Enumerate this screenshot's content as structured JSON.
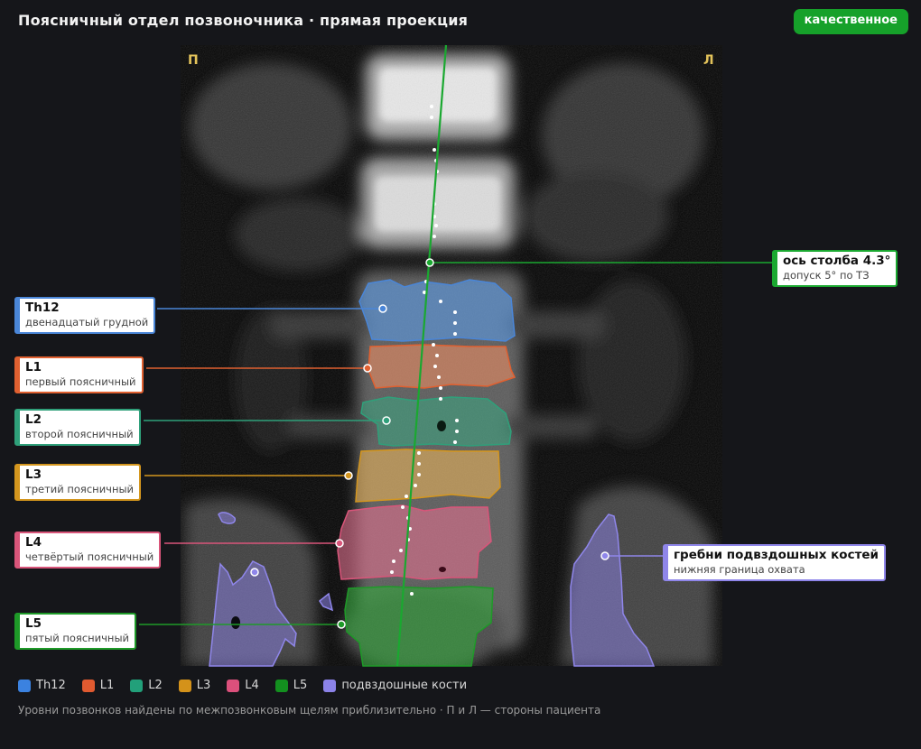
{
  "header": {
    "title": "Поясничный отдел позвоночника · прямая проекция",
    "quality_badge": "качественное"
  },
  "orientation": {
    "right_marker": "П",
    "left_marker": "Л"
  },
  "vertebrae": [
    {
      "id": "th12",
      "code": "Th12",
      "name": "двенадцатый грудной",
      "color": "#4a86d8"
    },
    {
      "id": "l1",
      "code": "L1",
      "name": "первый поясничный",
      "color": "#e06030"
    },
    {
      "id": "l2",
      "code": "L2",
      "name": "второй поясничный",
      "color": "#2fa07a"
    },
    {
      "id": "l3",
      "code": "L3",
      "name": "третий поясничный",
      "color": "#d4961e"
    },
    {
      "id": "l4",
      "code": "L4",
      "name": "четвёртый поясничный",
      "color": "#d9557a"
    },
    {
      "id": "l5",
      "code": "L5",
      "name": "пятый поясничный",
      "color": "#1e9a28"
    }
  ],
  "spine_axis": {
    "title": "ось столба 4.3°",
    "subtitle": "допуск 5° по ТЗ",
    "color": "#1aa830"
  },
  "iliac": {
    "title": "гребни подвздошных костей",
    "subtitle": "нижняя граница охвата",
    "color": "#8f86e6"
  },
  "legend": [
    {
      "label": "Th12",
      "color": "#3b82e0"
    },
    {
      "label": "L1",
      "color": "#e05a30"
    },
    {
      "label": "L2",
      "color": "#22a07a"
    },
    {
      "label": "L3",
      "color": "#d4921a"
    },
    {
      "label": "L4",
      "color": "#dc507c"
    },
    {
      "label": "L5",
      "color": "#13901f"
    },
    {
      "label": "подвздошные кости",
      "color": "#8b82e8"
    }
  ],
  "footnote": "Уровни позвонков найдены по межпозвонковым щелям приблизительно · П и Л — стороны пациента"
}
